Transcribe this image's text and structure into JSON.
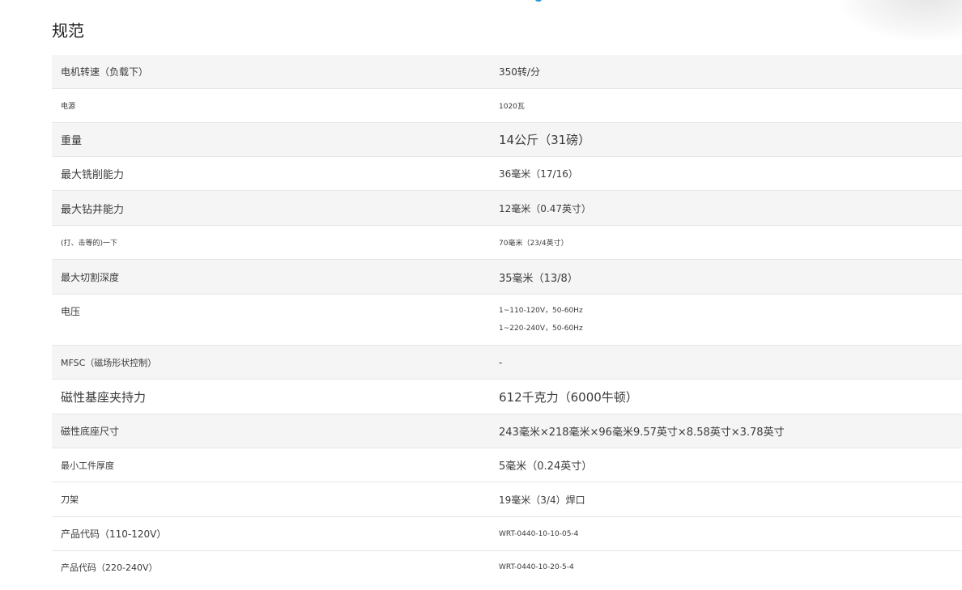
{
  "header": {
    "title": "规范"
  },
  "specs": [
    {
      "label": "电机转速（负载下）",
      "value": [
        "350转/分"
      ]
    },
    {
      "label": "电源",
      "value": [
        "1020瓦"
      ]
    },
    {
      "label": "重量",
      "value": [
        "14公斤（31磅）"
      ]
    },
    {
      "label": "最大铣削能力",
      "value": [
        "36毫米（17/16）"
      ]
    },
    {
      "label": "最大钻井能力",
      "value": [
        "12毫米（0.47英寸）"
      ]
    },
    {
      "label": "(打、击等的)一下",
      "value": [
        "70毫米（23/4英寸）"
      ]
    },
    {
      "label": "最大切割深度",
      "value": [
        "35毫米（13/8）"
      ]
    },
    {
      "label": "电压",
      "value": [
        "1~110-120V，50-60Hz",
        "1~220-240V，50-60Hz"
      ]
    },
    {
      "label": "MFSC（磁场形状控制）",
      "value": [
        "-"
      ]
    },
    {
      "label": "磁性基座夹持力",
      "value": [
        "612千克力（6000牛顿）"
      ]
    },
    {
      "label": "磁性底座尺寸",
      "value": [
        "243毫米×218毫米×96毫米9.57英寸×8.58英寸×3.78英寸"
      ]
    },
    {
      "label": "最小工件厚度",
      "value": [
        "5毫米（0.24英寸）"
      ]
    },
    {
      "label": "刀架",
      "value": [
        "19毫米（3/4）焊口"
      ]
    },
    {
      "label": "产品代码（110-120V）",
      "value": [
        "WRT-0440-10-10-05-4"
      ]
    },
    {
      "label": "产品代码（220-240V）",
      "value": [
        "WRT-0440-10-20-5-4"
      ]
    }
  ]
}
